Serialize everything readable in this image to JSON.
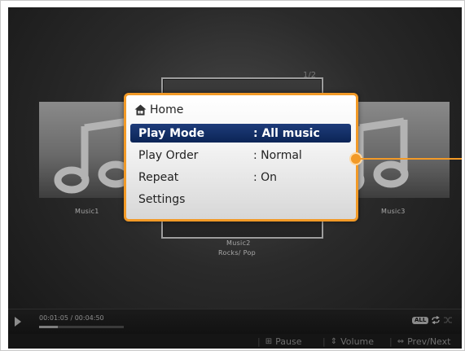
{
  "carousel": {
    "page_indicator": "1/2",
    "albums": [
      {
        "title": "Music1",
        "subtitle": ""
      },
      {
        "title": "Music2",
        "subtitle": "Rocks/ Pop"
      },
      {
        "title": "Music3",
        "subtitle": ""
      }
    ]
  },
  "menu": {
    "home_label": "Home",
    "items": [
      {
        "label": "Play Mode",
        "value": ": All music",
        "selected": true
      },
      {
        "label": "Play Order",
        "value": ": Normal",
        "selected": false
      },
      {
        "label": "Repeat",
        "value": ": On",
        "selected": false
      },
      {
        "label": "Settings",
        "value": "",
        "selected": false
      }
    ]
  },
  "player": {
    "elapsed": "00:01:05",
    "time_text": "00:01:05 / 00:04:50",
    "total": "00:04:50",
    "progress": 0.22,
    "repeat_badge": "ALL"
  },
  "hints": {
    "pause": "Pause",
    "volume": "Volume",
    "prev_next": "Prev/Next"
  },
  "colors": {
    "accent": "#f29a27",
    "selection": "#0f2a60"
  }
}
